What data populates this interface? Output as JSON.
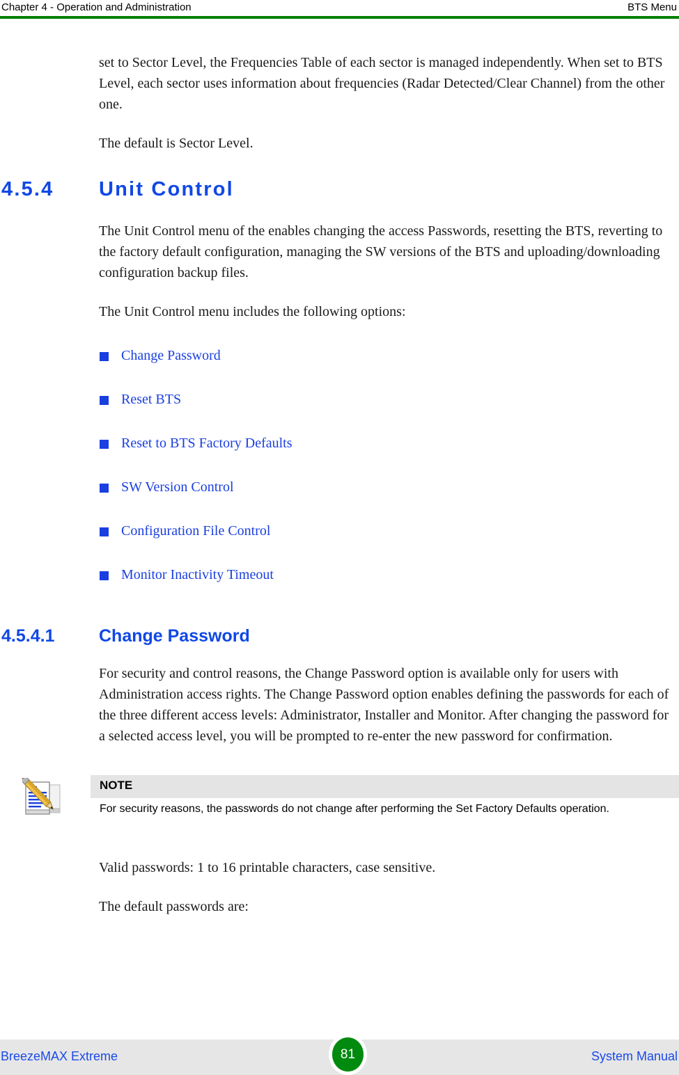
{
  "header": {
    "left": "Chapter 4 - Operation and Administration",
    "right": "BTS Menu",
    "rule_color": "#008000"
  },
  "body": {
    "intro_paragraph": "set to Sector Level, the Frequencies Table of each sector is managed independently. When set to BTS Level, each sector uses information about frequencies (Radar Detected/Clear Channel) from the other one.",
    "default_note": "The default is Sector Level."
  },
  "section": {
    "number": "4.5.4",
    "title": "Unit Control",
    "paragraph_1": "The Unit Control menu of the enables changing the access Passwords, resetting the BTS, reverting to the factory default configuration, managing the SW versions of the BTS and uploading/downloading configuration backup files.",
    "paragraph_2": "The Unit Control menu includes the following options:",
    "options": [
      {
        "label": "Change Password"
      },
      {
        "label": "Reset BTS"
      },
      {
        "label": "Reset to BTS Factory Defaults"
      },
      {
        "label": "SW Version Control"
      },
      {
        "label": "Configuration File Control"
      },
      {
        "label": "Monitor Inactivity Timeout"
      }
    ],
    "link_color": "#1a3fe0",
    "heading_color": "#1048e5"
  },
  "subsection": {
    "number": "4.5.4.1",
    "title": "Change Password",
    "paragraph_1": "For security and control reasons, the Change Password option is available only for users with Administration access rights. The Change Password option enables defining the passwords for each of the three different access levels: Administrator, Installer and Monitor. After changing the password for a selected access level, you will be prompted to re-enter the new password for confirmation.",
    "paragraph_2": "Valid passwords: 1 to 16 printable characters, case sensitive.",
    "paragraph_3": "The default passwords are:"
  },
  "note": {
    "icon_name": "note-pencil-notepad-icon",
    "title": "NOTE",
    "text": "For security reasons, the passwords do not change after performing the Set Factory Defaults operation.",
    "band_color": "#e4e4e4"
  },
  "footer": {
    "left": "BreezeMAX Extreme",
    "page_number": "81",
    "right": "System Manual",
    "band_color": "#e6e6e6",
    "badge_color": "#008a0e"
  }
}
